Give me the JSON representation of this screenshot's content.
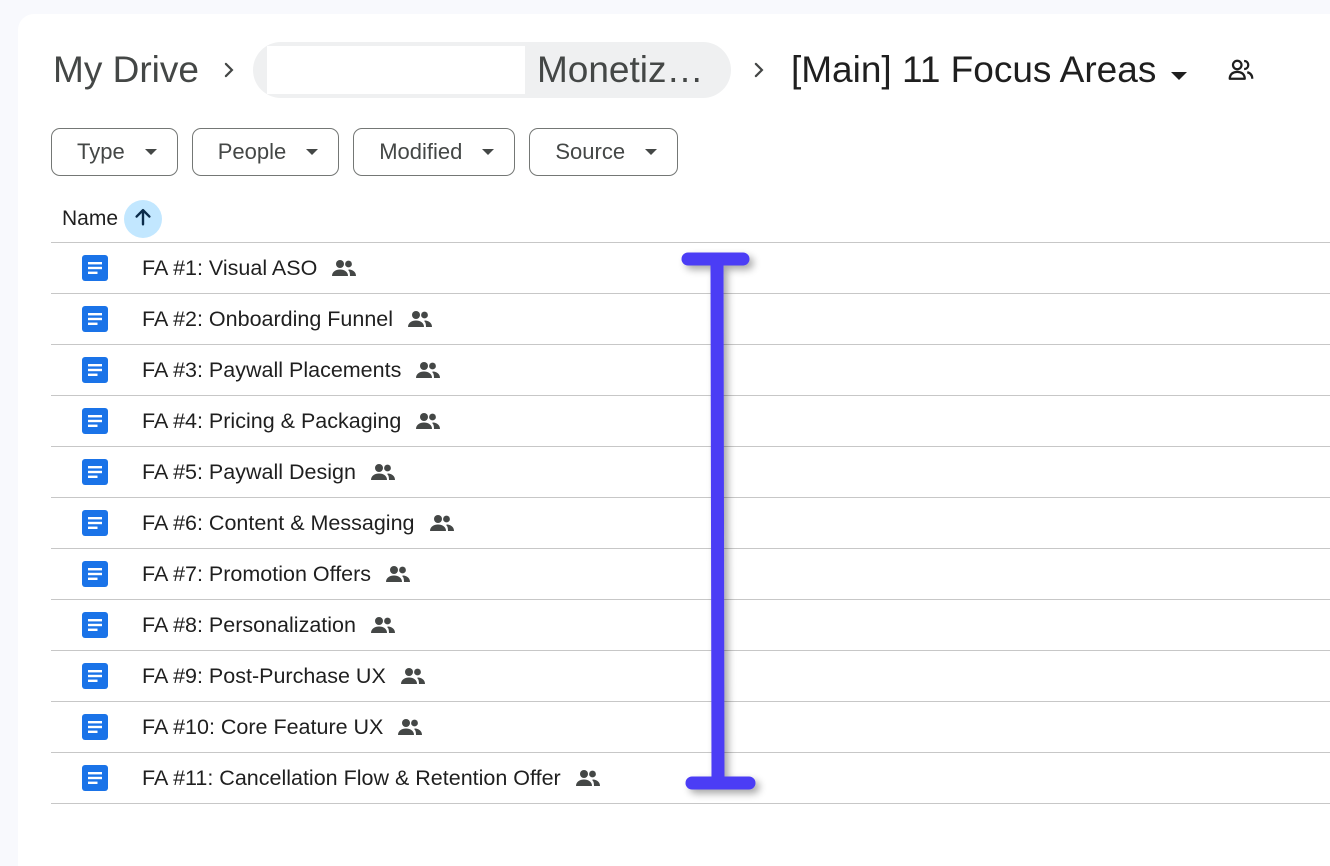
{
  "breadcrumb": {
    "root": "My Drive",
    "middle": "Monetiz…",
    "current": "[Main] 11 Focus Areas"
  },
  "filters": [
    {
      "label": "Type"
    },
    {
      "label": "People"
    },
    {
      "label": "Modified"
    },
    {
      "label": "Source"
    }
  ],
  "list": {
    "name_header": "Name",
    "rows": [
      {
        "name": "FA #1: Visual ASO"
      },
      {
        "name": "FA #2: Onboarding Funnel"
      },
      {
        "name": "FA #3: Paywall Placements"
      },
      {
        "name": "FA #4: Pricing & Packaging"
      },
      {
        "name": "FA #5: Paywall Design"
      },
      {
        "name": "FA #6: Content & Messaging"
      },
      {
        "name": "FA #7: Promotion Offers"
      },
      {
        "name": "FA #8: Personalization"
      },
      {
        "name": "FA #9: Post-Purchase UX"
      },
      {
        "name": "FA #10: Core Feature UX"
      },
      {
        "name": "FA #11: Cancellation Flow & Retention Offer"
      }
    ]
  },
  "colors": {
    "doc_icon": "#1a73e8",
    "sort_highlight": "#c2e7ff",
    "bracket": "#4b3cf5"
  },
  "icons": {
    "separator": "chevron-right-icon",
    "dropdown": "caret-down-icon",
    "share": "people-outline-icon",
    "sort": "arrow-up-icon",
    "file": "google-doc-icon",
    "shared": "people-icon"
  }
}
